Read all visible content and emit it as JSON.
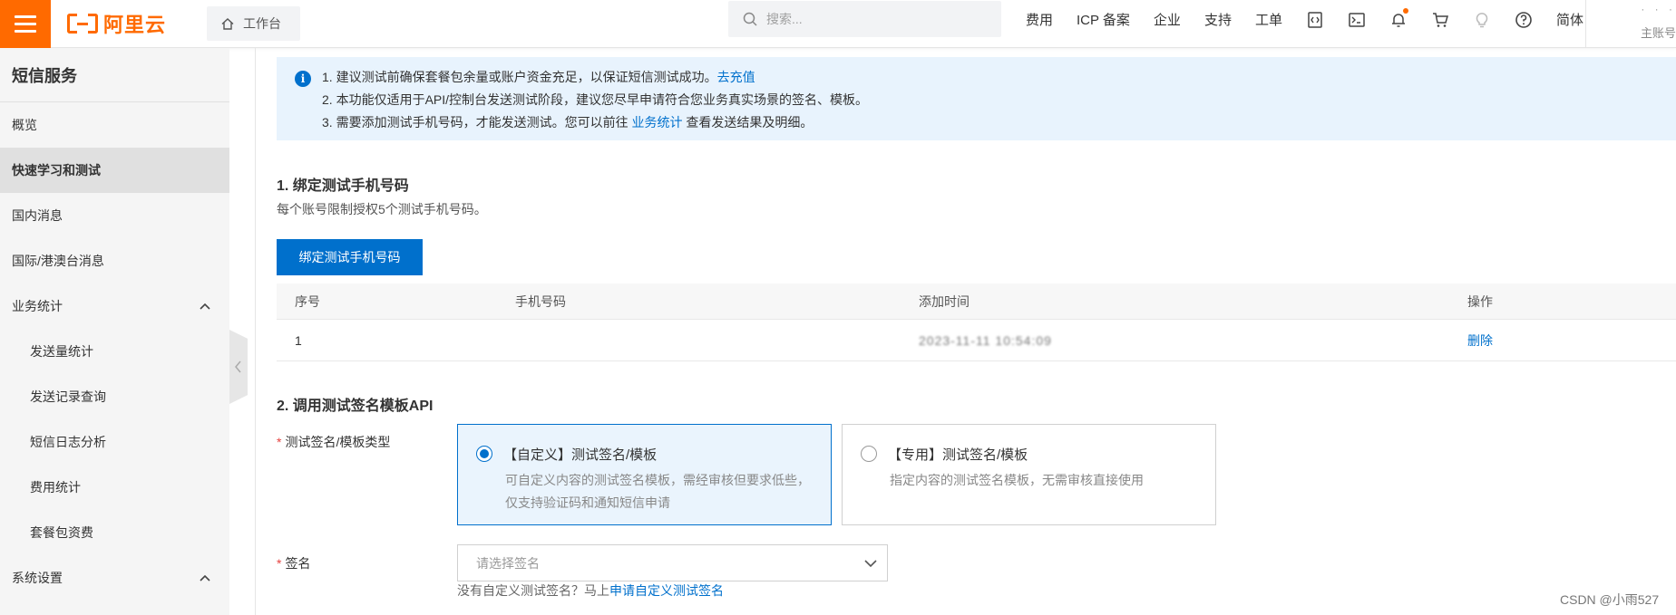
{
  "topbar": {
    "logo_text": "阿里云",
    "workbench_label": "工作台",
    "search_placeholder": "搜索...",
    "links": [
      "费用",
      "ICP 备案",
      "企业",
      "支持",
      "工单"
    ],
    "lang": "简体",
    "account_sub": "主账号",
    "icons": [
      "code-icon",
      "terminal-icon",
      "bell-icon",
      "cart-icon",
      "bulb-icon",
      "help-icon"
    ]
  },
  "sidebar": {
    "title": "短信服务",
    "items": [
      {
        "label": "概览"
      },
      {
        "label": "快速学习和测试"
      },
      {
        "label": "国内消息"
      },
      {
        "label": "国际/港澳台消息"
      },
      {
        "label": "业务统计"
      },
      {
        "label": "发送量统计"
      },
      {
        "label": "发送记录查询"
      },
      {
        "label": "短信日志分析"
      },
      {
        "label": "费用统计"
      },
      {
        "label": "套餐包资费"
      },
      {
        "label": "系统设置"
      }
    ]
  },
  "notice": {
    "line1": "1. 建议测试前确保套餐包余量或账户资金充足，以保证短信测试成功。",
    "line1_link": "去充值",
    "line2": "2. 本功能仅适用于API/控制台发送测试阶段，建议您尽早申请符合您业务真实场景的签名、模板。",
    "line3_a": "3. 需要添加测试手机号码，才能发送测试。您可以前往",
    "line3_link": "业务统计",
    "line3_b": "查看发送结果及明细。"
  },
  "section1": {
    "title": "1. 绑定测试手机号码",
    "desc": "每个账号限制授权5个测试手机号码。",
    "button": "绑定测试手机号码",
    "table": {
      "headers": [
        "序号",
        "手机号码",
        "添加时间",
        "操作"
      ],
      "rows": [
        {
          "index": "1",
          "phone": "",
          "time": "2023-11-11 10:54:09",
          "action": "删除"
        }
      ]
    }
  },
  "section2": {
    "title": "2. 调用测试签名模板API",
    "type_label": "测试签名/模板类型",
    "card_custom_title": "【自定义】测试签名/模板",
    "card_custom_desc": "可自定义内容的测试签名模板，需经审核但要求低些，仅支持验证码和通知短信申请",
    "card_special_title": "【专用】测试签名/模板",
    "card_special_desc": "指定内容的测试签名模板，无需审核直接使用",
    "sign_label": "签名",
    "sign_placeholder": "请选择签名",
    "help_text": "没有自定义测试签名？马上",
    "help_link": "申请自定义测试签名"
  },
  "watermark": "CSDN @小雨527"
}
